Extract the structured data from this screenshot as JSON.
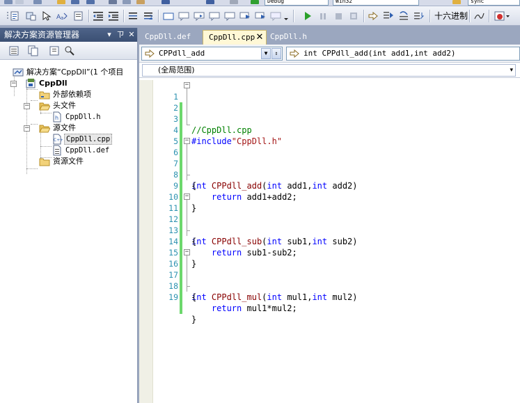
{
  "top_toolbar": {
    "config_combo": "Debug",
    "platform_combo": "Win32",
    "find_combo": "sync"
  },
  "main_toolbar": {
    "hex_label": "十六进制"
  },
  "solution_explorer": {
    "title": "解决方案资源管理器",
    "pin_glyph": "ㄗ",
    "close_glyph": "✕",
    "dropdown_glyph": "▾",
    "tree": {
      "solution": "解决方案“CppDll”(1 个项目",
      "project": "CppDll",
      "external_deps": "外部依赖项",
      "header_files": "头文件",
      "header_file_1": "CppDll.h",
      "source_files": "源文件",
      "source_file_1": "CppDll.cpp",
      "source_file_2": "CppDll.def",
      "resource_files": "资源文件"
    }
  },
  "editor": {
    "tabs": [
      {
        "label": "CppDll.def"
      },
      {
        "label": "CppDll.cpp"
      },
      {
        "label": "CppDll.h"
      }
    ],
    "tab_close_glyph": "✕",
    "nav": {
      "scope_combo": "CPPdll_add",
      "member_combo": "int CPPdll_add(int add1,int add2)"
    },
    "scope_bar": "(全局范围)",
    "code": [
      {
        "n": "1",
        "t": "//CppDll.cpp"
      },
      {
        "n": "2",
        "t": ""
      },
      {
        "n": "3",
        "t": "#include\"CppDll.h\""
      },
      {
        "n": "4",
        "t": ""
      },
      {
        "n": "5",
        "t": ""
      },
      {
        "n": "6",
        "t": "int CPPdll_add(int add1,int add2)"
      },
      {
        "n": "7",
        "t": "{"
      },
      {
        "n": "8",
        "t": "    return add1+add2;"
      },
      {
        "n": "9",
        "t": "}"
      },
      {
        "n": "10",
        "t": ""
      },
      {
        "n": "11",
        "t": "int CPPdll_sub(int sub1,int sub2)"
      },
      {
        "n": "12",
        "t": "{"
      },
      {
        "n": "13",
        "t": "    return sub1-sub2;"
      },
      {
        "n": "14",
        "t": "}"
      },
      {
        "n": "15",
        "t": ""
      },
      {
        "n": "16",
        "t": "int CPPdll_mul(int mul1,int mul2)"
      },
      {
        "n": "17",
        "t": "{"
      },
      {
        "n": "18",
        "t": "    return mul1*mul2;"
      },
      {
        "n": "19",
        "t": "}"
      }
    ]
  },
  "colors": {
    "keyword": "#0000ff",
    "comment": "#008000",
    "line_number": "#2b91af",
    "change_bar": "#6cd86c",
    "panel_title": "#3b4f73",
    "ide_background": "#9ba7bf"
  }
}
